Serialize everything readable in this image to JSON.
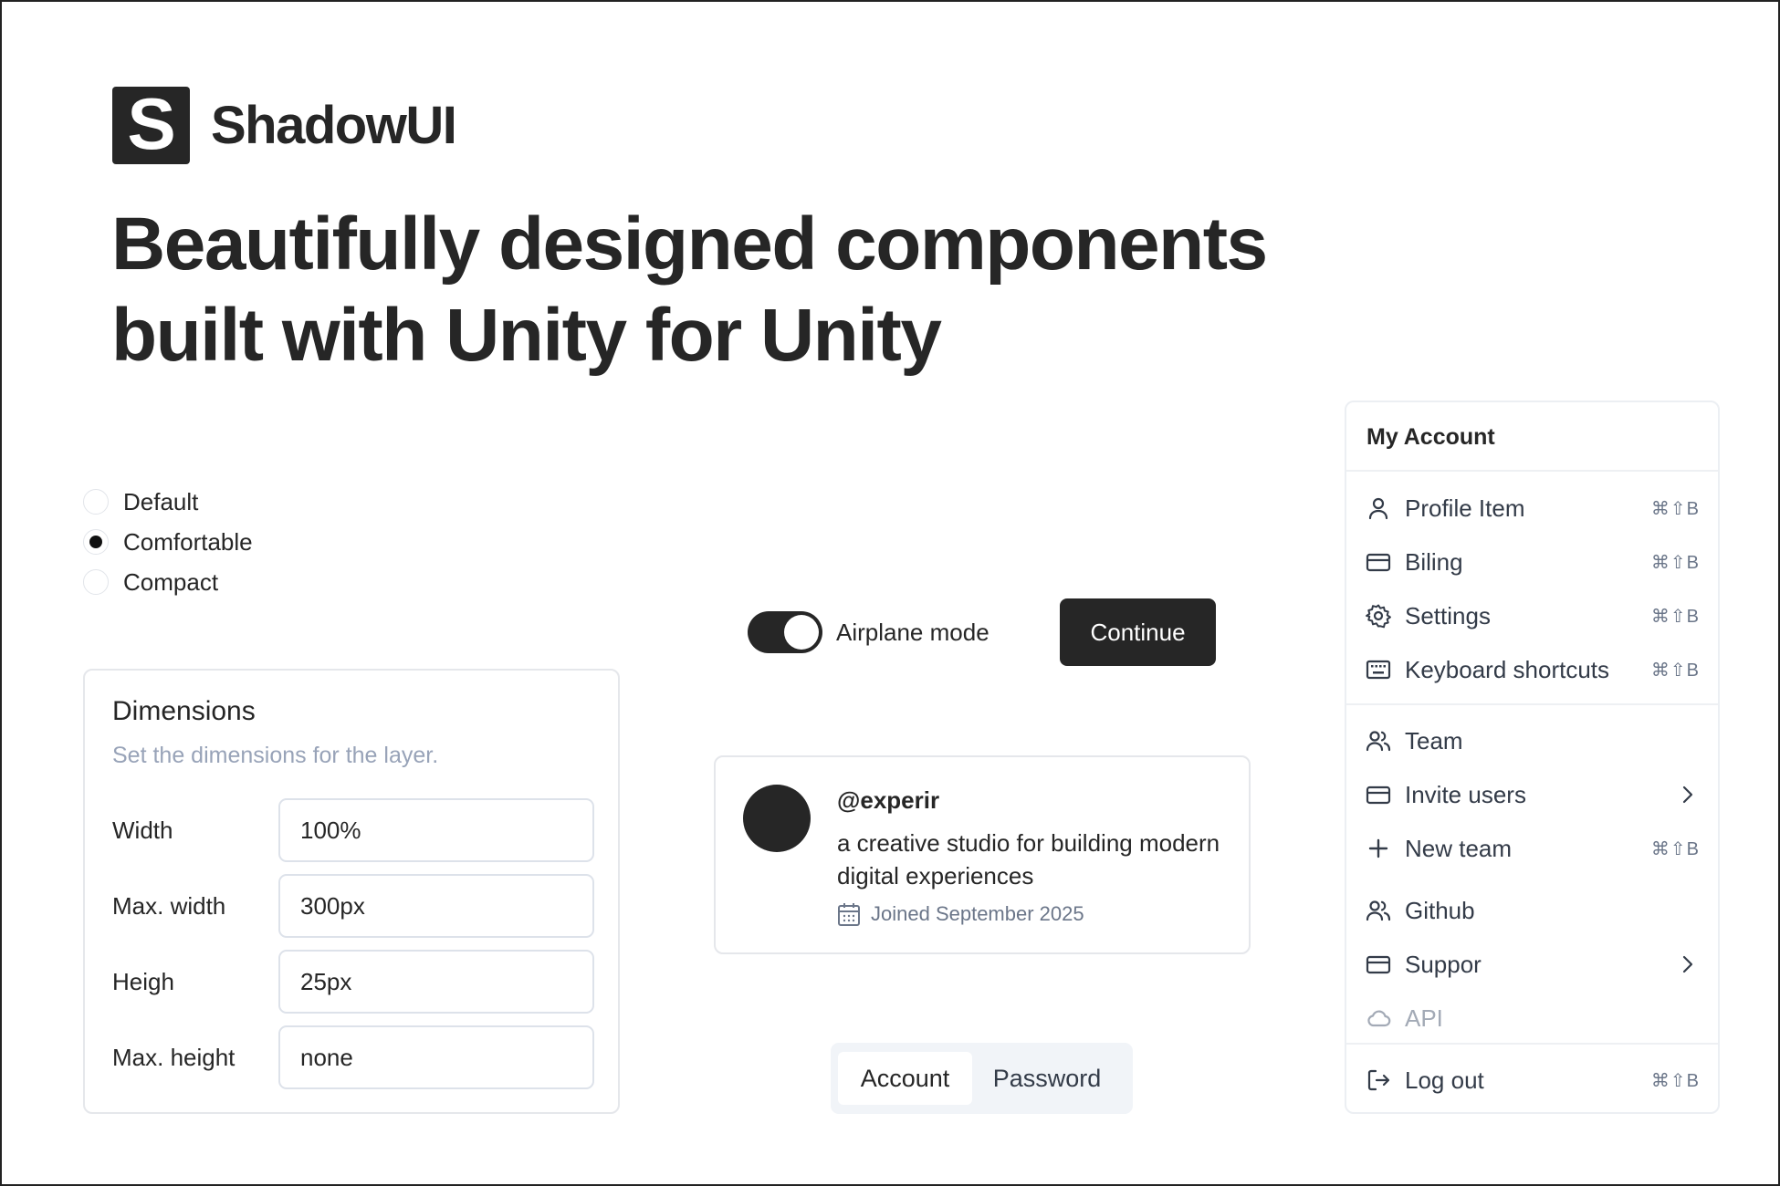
{
  "brand": {
    "logo_letter": "S",
    "name": "ShadowUI"
  },
  "headline": {
    "line1": "Beautifully designed components",
    "line2": "built with Unity for Unity"
  },
  "radio_group": {
    "selected": "Comfortable",
    "options": [
      {
        "label": "Default",
        "checked": false
      },
      {
        "label": "Comfortable",
        "checked": true
      },
      {
        "label": "Compact",
        "checked": false
      }
    ]
  },
  "dimensions": {
    "title": "Dimensions",
    "description": "Set the dimensions for the layer.",
    "fields": [
      {
        "label": "Width",
        "value": "100%"
      },
      {
        "label": "Max. width",
        "value": "300px"
      },
      {
        "label": "Heigh",
        "value": "25px"
      },
      {
        "label": "Max. height",
        "value": "none"
      }
    ]
  },
  "toggle": {
    "label": "Airplane mode",
    "on": true
  },
  "continue_button": {
    "label": "Continue"
  },
  "profile": {
    "handle": "@experir",
    "bio": "a creative studio for building modern digital experiences",
    "joined": "Joined September 2025"
  },
  "tabs": {
    "items": [
      "Account",
      "Password"
    ],
    "active": "Account"
  },
  "menu": {
    "title": "My Account",
    "items": [
      {
        "label": "Profile Item",
        "icon": "user-icon",
        "shortcut": "⌘⇧B"
      },
      {
        "label": "Biling",
        "icon": "credit-card-icon",
        "shortcut": "⌘⇧B"
      },
      {
        "label": "Settings",
        "icon": "gear-icon",
        "shortcut": "⌘⇧B"
      },
      {
        "label": "Keyboard shortcuts",
        "icon": "keyboard-icon",
        "shortcut": "⌘⇧B"
      },
      {
        "label": "Team",
        "icon": "users-icon"
      },
      {
        "label": "Invite users",
        "icon": "credit-card-icon",
        "submenu": true
      },
      {
        "label": "New team",
        "icon": "plus-icon",
        "shortcut": "⌘⇧B"
      },
      {
        "label": "Github",
        "icon": "users-icon"
      },
      {
        "label": "Suppor",
        "icon": "credit-card-icon",
        "submenu": true
      },
      {
        "label": "API",
        "icon": "cloud-icon",
        "disabled": true
      },
      {
        "label": "Log out",
        "icon": "log-out-icon",
        "shortcut": "⌘⇧B"
      }
    ]
  },
  "colors": {
    "primary": "#262626",
    "muted_text": "#98a3b8",
    "border": "#e5e7eb",
    "tabs_bg": "#f1f4f8"
  }
}
